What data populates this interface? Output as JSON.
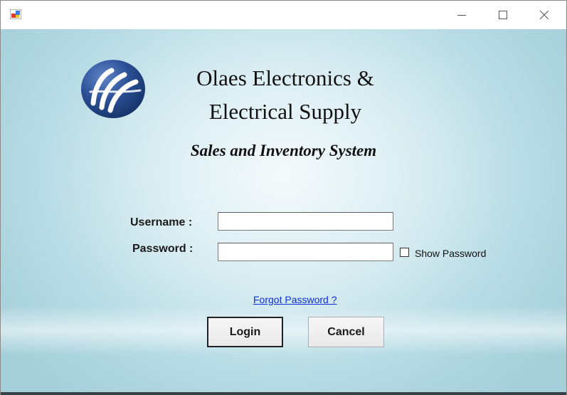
{
  "window": {
    "icon": "form-icon",
    "controls": {
      "minimize": "minimize-icon",
      "maximize": "maximize-icon",
      "close": "close-icon"
    }
  },
  "header": {
    "company_line1": "Olaes Electronics &",
    "company_line2": "Electrical Supply",
    "system_title": "Sales and Inventory System",
    "logo_icon": "company-logo-icon"
  },
  "form": {
    "username_label": "Username :",
    "username_value": "",
    "password_label": "Password :",
    "password_value": "",
    "show_password_label": "Show Password",
    "show_password_checked": false,
    "forgot_password_link": "Forgot Password ?",
    "login_label": "Login",
    "cancel_label": "Cancel"
  },
  "colors": {
    "link": "#0b2ee0",
    "background_center": "#f5fafc",
    "background_edge": "#a4cfd9",
    "logo_blue": "#2a4e94"
  }
}
